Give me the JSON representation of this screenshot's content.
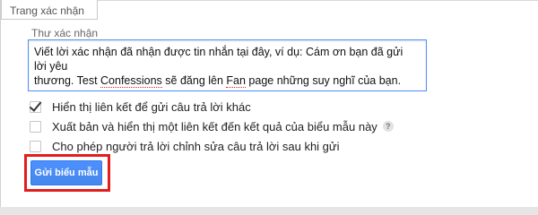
{
  "panel": {
    "tab_title": "Trang xác nhận"
  },
  "confirmation": {
    "field_label": "Thư xác nhận",
    "message_line1": "Viết lời xác nhận đã nhận được tin nhắn tại đây, ví dụ: Cám ơn bạn đã gửi lời yêu",
    "message_line2_a": "thương. Test ",
    "message_line2_b": "Confessions",
    "message_line2_c": " sẽ đăng lên ",
    "message_line2_d": "Fan",
    "message_line2_e": " page những suy nghĩ của bạn."
  },
  "options": [
    {
      "label": "Hiển thị liên kết để gửi câu trả lời khác",
      "checked": true
    },
    {
      "label": "Xuất bản và hiển thị một liên kết đến kết quả của biểu mẫu này",
      "checked": false,
      "help_icon": "?"
    },
    {
      "label": "Cho phép người trả lời chỉnh sửa câu trả lời sau khi gửi",
      "checked": false
    }
  ],
  "submit_button": {
    "label": "Gửi biểu mẫu"
  },
  "colors": {
    "accent": "#4d90fe",
    "highlight": "#e21d1d"
  }
}
